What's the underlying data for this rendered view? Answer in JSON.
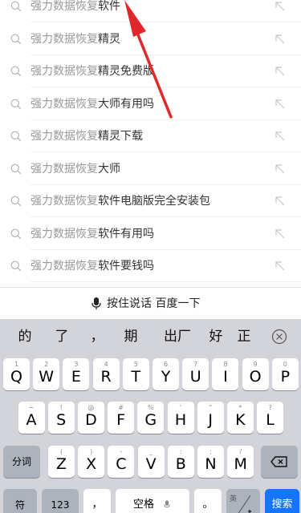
{
  "suggestions": [
    {
      "query": "强力数据恢复",
      "completion": "软件"
    },
    {
      "query": "强力数据恢复",
      "completion": "精灵"
    },
    {
      "query": "强力数据恢复",
      "completion": "精灵免费版"
    },
    {
      "query": "强力数据恢复",
      "completion": "大师有用吗"
    },
    {
      "query": "强力数据恢复",
      "completion": "精灵下载"
    },
    {
      "query": "强力数据恢复",
      "completion": "大师"
    },
    {
      "query": "强力数据恢复",
      "completion": "软件电脑版完全安装包"
    },
    {
      "query": "强力数据恢复",
      "completion": "软件有用吗"
    },
    {
      "query": "强力数据恢复",
      "completion": "软件要钱吗"
    }
  ],
  "icons": {
    "suggestion_leading": "search-icon",
    "suggestion_trailing": "fill-arrow-icon",
    "voice": "microphone-icon",
    "candidate_close": "close-circle-icon",
    "delete": "backspace-icon"
  },
  "voice_bar": {
    "label": "按住说话 百度一下"
  },
  "candidates": [
    "的",
    "了",
    "，",
    "期",
    "出厂",
    "好",
    "正"
  ],
  "keyboard": {
    "row1": [
      {
        "hint": "1",
        "key": "Q"
      },
      {
        "hint": "2",
        "key": "W"
      },
      {
        "hint": "3",
        "key": "E"
      },
      {
        "hint": "4",
        "key": "R"
      },
      {
        "hint": "5",
        "key": "T"
      },
      {
        "hint": "6",
        "key": "Y"
      },
      {
        "hint": "7",
        "key": "U"
      },
      {
        "hint": "8",
        "key": "I"
      },
      {
        "hint": "9",
        "key": "O"
      },
      {
        "hint": "0",
        "key": "P"
      }
    ],
    "row2": [
      {
        "hint": "~",
        "key": "A"
      },
      {
        "hint": "!",
        "key": "S"
      },
      {
        "hint": "@",
        "key": "D"
      },
      {
        "hint": "#",
        "key": "F"
      },
      {
        "hint": "%",
        "key": "G"
      },
      {
        "hint": "'",
        "key": "H"
      },
      {
        "hint": "\"",
        "key": "J"
      },
      {
        "hint": "*",
        "key": "K"
      },
      {
        "hint": "?",
        "key": "L"
      }
    ],
    "row3": [
      {
        "hint": "(",
        "key": "Z"
      },
      {
        "hint": ")",
        "key": "X"
      },
      {
        "hint": "-",
        "key": "C"
      },
      {
        "hint": "_",
        "key": "V"
      },
      {
        "hint": ":",
        "key": "B"
      },
      {
        "hint": ";",
        "key": "N"
      },
      {
        "hint": "/",
        "key": "M"
      }
    ],
    "split_label": "分词",
    "symbol_label": "符",
    "number_label": "123",
    "comma_label": "，",
    "space_label": "空格",
    "period_label": "。",
    "lang_label": "英",
    "search_label": "搜索"
  },
  "colors": {
    "accent": "#1675ff",
    "annotation_arrow": "#e0282b",
    "keyboard_bg": "#d2d4d9",
    "function_key": "#adb3bc"
  }
}
